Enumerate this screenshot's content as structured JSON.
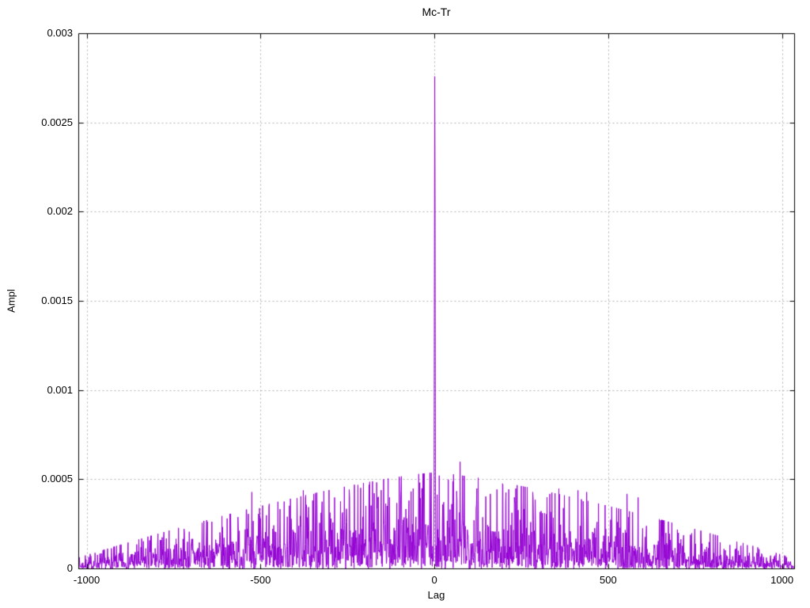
{
  "page": {
    "background": "#ffffff"
  },
  "chart_data": {
    "type": "line",
    "style": "dense noisy cross-correlation trace with sharp central peak",
    "title": "Mc-Tr",
    "xlabel": "Lag",
    "ylabel": "Ampl",
    "line_color": "#9400d3",
    "axis_color": "#000000",
    "grid": true,
    "grid_color": "#b0b0b0",
    "xlim": [
      -1024,
      1035
    ],
    "ylim": [
      0,
      0.003
    ],
    "x_ticks": [
      {
        "value": -1000,
        "label": "-1000"
      },
      {
        "value": -500,
        "label": "-500"
      },
      {
        "value": 0,
        "label": "0"
      },
      {
        "value": 500,
        "label": "500"
      },
      {
        "value": 1000,
        "label": "1000"
      }
    ],
    "y_ticks": [
      {
        "value": 0,
        "label": "0"
      },
      {
        "value": 0.0005,
        "label": "0.0005"
      },
      {
        "value": 0.001,
        "label": "0.001"
      },
      {
        "value": 0.0015,
        "label": "0.0015"
      },
      {
        "value": 0.002,
        "label": "0.002"
      },
      {
        "value": 0.0025,
        "label": "0.0025"
      },
      {
        "value": 0.003,
        "label": "0.003"
      }
    ],
    "legend": "none",
    "main_peak": {
      "lag": 0,
      "value": 0.00276
    },
    "secondary_peaks": [
      {
        "lag": -1,
        "value": 0.00162
      },
      {
        "lag": 1,
        "value": 0.00204
      },
      {
        "lag": -2,
        "value": 0.00045
      },
      {
        "lag": 2,
        "value": 0.0005
      },
      {
        "lag": -526,
        "value": 0.00043
      },
      {
        "lag": -378,
        "value": 0.00044
      },
      {
        "lag": -348,
        "value": 0.00042
      },
      {
        "lag": -288,
        "value": 0.0004
      },
      {
        "lag": -221,
        "value": 0.00047
      },
      {
        "lag": -130,
        "value": 0.0004
      },
      {
        "lag": -62,
        "value": 0.00045
      },
      {
        "lag": 39,
        "value": 0.0005
      },
      {
        "lag": 52,
        "value": 0.00049
      },
      {
        "lag": 73,
        "value": 0.0006
      },
      {
        "lag": 125,
        "value": 0.00051
      },
      {
        "lag": 160,
        "value": 0.00042
      },
      {
        "lag": 196,
        "value": 0.00047
      },
      {
        "lag": 233,
        "value": 0.00045
      },
      {
        "lag": 282,
        "value": 0.00043
      },
      {
        "lag": 331,
        "value": 0.00042
      },
      {
        "lag": 357,
        "value": 0.00045
      },
      {
        "lag": 412,
        "value": 0.00044
      },
      {
        "lag": 437,
        "value": 0.00043
      },
      {
        "lag": 553,
        "value": 0.00042
      },
      {
        "lag": 585,
        "value": 0.0004
      }
    ],
    "noise_model": {
      "seed": 7,
      "base_level": 2e-05,
      "center_level": 0.00018,
      "half_width": 1030,
      "taper_exponent": 1.3,
      "distribution": "exponential",
      "clip_factor": 3.0
    }
  }
}
